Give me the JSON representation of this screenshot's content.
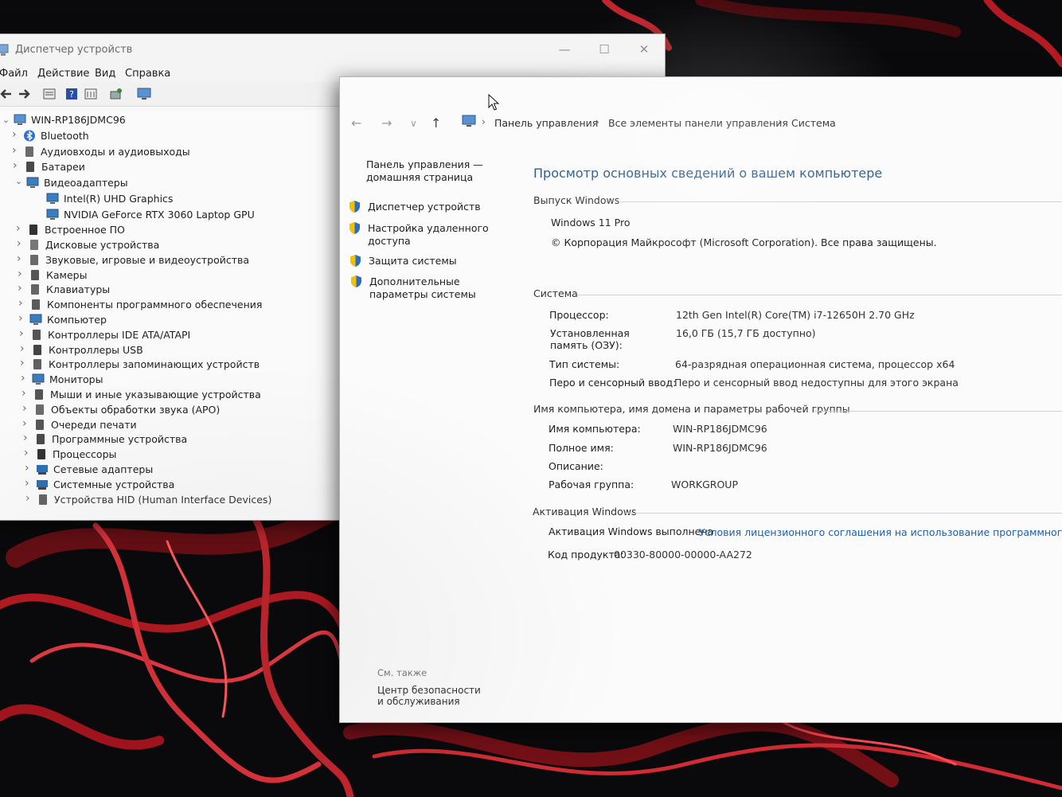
{
  "colors": {
    "accent_heading": "#2c5a86",
    "link": "#1f5fa8",
    "wallpaper_red": "#c8222a",
    "shield_blue": "#2b6cc4",
    "shield_yellow": "#f2c200"
  },
  "device_manager": {
    "title": "Диспетчер устройств",
    "window_controls": {
      "minimize": "—",
      "maximize": "☐",
      "close": "✕"
    },
    "menu": [
      "Файл",
      "Действие",
      "Вид",
      "Справка"
    ],
    "toolbar_icons": [
      "back-arrow-icon",
      "forward-arrow-icon",
      "properties-icon",
      "help-icon",
      "details-icon",
      "scan-hardware-icon",
      "monitor-icon"
    ],
    "root": "WIN-RP186JDMC96",
    "tree": [
      {
        "label": "Bluetooth",
        "icon": "bluetooth-icon",
        "expanded": false
      },
      {
        "label": "Аудиовходы и аудиовыходы",
        "icon": "speaker-icon",
        "expanded": false
      },
      {
        "label": "Батареи",
        "icon": "battery-icon",
        "expanded": false
      },
      {
        "label": "Видеоадаптеры",
        "icon": "display-adapter-icon",
        "expanded": true
      },
      {
        "label": "Intel(R) UHD Graphics",
        "icon": "display-adapter-icon",
        "child": true
      },
      {
        "label": "NVIDIA GeForce RTX 3060 Laptop GPU",
        "icon": "display-adapter-icon",
        "child": true
      },
      {
        "label": "Встроенное ПО",
        "icon": "firmware-icon",
        "expanded": false
      },
      {
        "label": "Дисковые устройства",
        "icon": "disk-icon",
        "expanded": false
      },
      {
        "label": "Звуковые, игровые и видеоустройства",
        "icon": "speaker-icon",
        "expanded": false
      },
      {
        "label": "Камеры",
        "icon": "camera-icon",
        "expanded": false
      },
      {
        "label": "Клавиатуры",
        "icon": "keyboard-icon",
        "expanded": false
      },
      {
        "label": "Компоненты программного обеспечения",
        "icon": "software-component-icon",
        "expanded": false
      },
      {
        "label": "Компьютер",
        "icon": "computer-icon",
        "expanded": false
      },
      {
        "label": "Контроллеры IDE ATA/ATAPI",
        "icon": "ide-controller-icon",
        "expanded": false
      },
      {
        "label": "Контроллеры USB",
        "icon": "usb-icon",
        "expanded": false
      },
      {
        "label": "Контроллеры запоминающих устройств",
        "icon": "storage-controller-icon",
        "expanded": false
      },
      {
        "label": "Мониторы",
        "icon": "monitor-icon",
        "expanded": false
      },
      {
        "label": "Мыши и иные указывающие устройства",
        "icon": "mouse-icon",
        "expanded": false
      },
      {
        "label": "Объекты обработки звука (APO)",
        "icon": "speaker-icon",
        "expanded": false
      },
      {
        "label": "Очереди печати",
        "icon": "printer-icon",
        "expanded": false
      },
      {
        "label": "Программные устройства",
        "icon": "software-device-icon",
        "expanded": false
      },
      {
        "label": "Процессоры",
        "icon": "processor-icon",
        "expanded": false
      },
      {
        "label": "Сетевые адаптеры",
        "icon": "network-adapter-icon",
        "expanded": false
      },
      {
        "label": "Системные устройства",
        "icon": "system-device-icon",
        "expanded": false
      },
      {
        "label": "Устройства HID (Human Interface Devices)",
        "icon": "hid-icon",
        "expanded": false
      }
    ]
  },
  "system_window": {
    "nav": {
      "back": "←",
      "forward": "→",
      "recent": "∨",
      "up": "↑"
    },
    "breadcrumb": [
      "Панель управления",
      "Все элементы панели управления",
      "Система"
    ],
    "sidebar": {
      "home": "Панель управления — домашняя страница",
      "links": [
        "Диспетчер устройств",
        "Настройка удаленного доступа",
        "Защита системы",
        "Дополнительные параметры системы"
      ],
      "see_also": "См. также",
      "see_also_links": [
        "Центр безопасности и обслуживания"
      ]
    },
    "heading": "Просмотр основных сведений о вашем компьютере",
    "edition": {
      "section": "Выпуск Windows",
      "name": "Windows 11 Pro",
      "copyright": "© Корпорация Майкрософт (Microsoft Corporation). Все права защищены."
    },
    "system": {
      "section": "Система",
      "processor_label": "Процессор:",
      "processor_value": "12th Gen Intel(R) Core(TM) i7-12650H   2.70 GHz",
      "memory_label": "Установленная память (ОЗУ):",
      "memory_value": "16,0 ГБ (15,7 ГБ доступно)",
      "type_label": "Тип системы:",
      "type_value": "64-разрядная операционная система, процессор x64",
      "pen_label": "Перо и сенсорный ввод:",
      "pen_value": "Перо и сенсорный ввод недоступны для этого экрана"
    },
    "computer_name": {
      "section": "Имя компьютера, имя домена и параметры рабочей группы",
      "name_label": "Имя компьютера:",
      "name_value": "WIN-RP186JDMC96",
      "full_label": "Полное имя:",
      "full_value": "WIN-RP186JDMC96",
      "desc_label": "Описание:",
      "desc_value": "",
      "workgroup_label": "Рабочая группа:",
      "workgroup_value": "WORKGROUP"
    },
    "activation": {
      "section": "Активация Windows",
      "status": "Активация Windows выполнена",
      "license_link": "Условия лицензионного соглашения на использование программного обеспече",
      "product_label": "Код продукта:",
      "product_value": "00330-80000-00000-AA272"
    }
  }
}
